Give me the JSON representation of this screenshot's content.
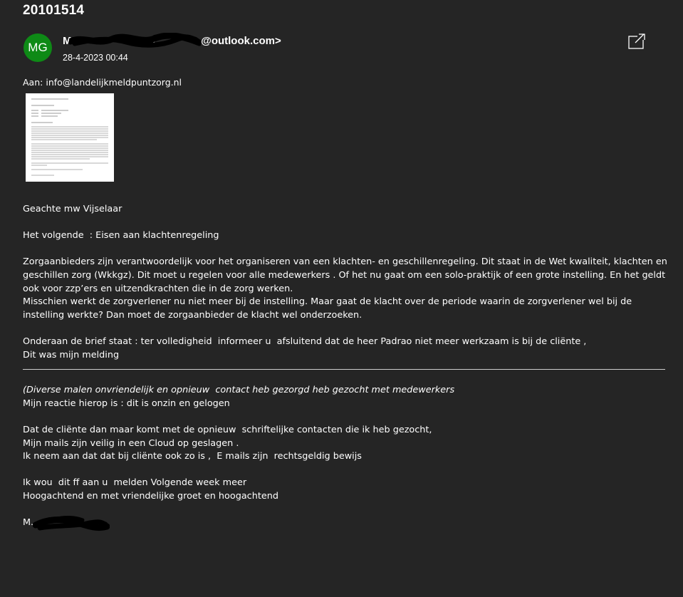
{
  "window": {
    "title": "20101514"
  },
  "header": {
    "avatar_initials": "MG",
    "sender_prefix": "M",
    "sender_mid": "ma",
    "sender_suffix": "@outlook.com>",
    "date": "28-4-2023 00:44",
    "popout_icon": "open-in-new-window-icon",
    "avatar_color": "#0e8a16"
  },
  "recipient": {
    "label": "Aan:",
    "address": "info@landelijkmeldpuntzorg.nl"
  },
  "attachment": {
    "icon": "scanned-letter-thumbnail"
  },
  "body": {
    "salutation": "Geachte mw Vijselaar",
    "subject_line": "Het volgende  : Eisen aan klachtenregeling",
    "para1": "Zorgaanbieders zijn verantwoordelijk voor het organiseren van een klachten- en geschillenregeling. Dit staat in de Wet kwaliteit, klachten en geschillen zorg (Wkkgz). Dit moet u regelen voor alle medewerkers . Of het nu gaat om een solo-praktijk of een grote instelling. En het geldt ook voor zzp’ers en uitzendkrachten die in de zorg werken.",
    "para2": "Misschien werkt de zorgverlener nu niet meer bij de instelling. Maar gaat de klacht over de periode waarin de zorgverlener wel bij de instelling werkte? Dan moet de zorgaanbieder de klacht wel onderzoeken.",
    "para3": "Onderaan de brief staat : ter volledigheid  informeer u  afsluitend dat de heer Padrao niet meer werkzaam is bij de cliënte ,",
    "para4": "Dit was mijn melding",
    "quote": "(Diverse malen onvriendelijk en opnieuw  contact heb gezorgd heb gezocht met medewerkers",
    "reply1": "Mijn reactie hierop is : dit is onzin en gelogen",
    "line1": "Dat de cliënte dan maar komt met de opnieuw  schriftelijke contacten die ik heb gezocht,",
    "line2": "Mijn mails zijn veilig in een Cloud op geslagen .",
    "line3": "Ik neem aan dat dat bij cliënte ook zo is ,  E mails zijn  rechtsgeldig bewijs",
    "line4": "Ik wou  dit ff aan u  melden Volgende week meer",
    "line5": "Hoogachtend en met vriendelijke groet en hoogachtend",
    "signature": "M."
  }
}
